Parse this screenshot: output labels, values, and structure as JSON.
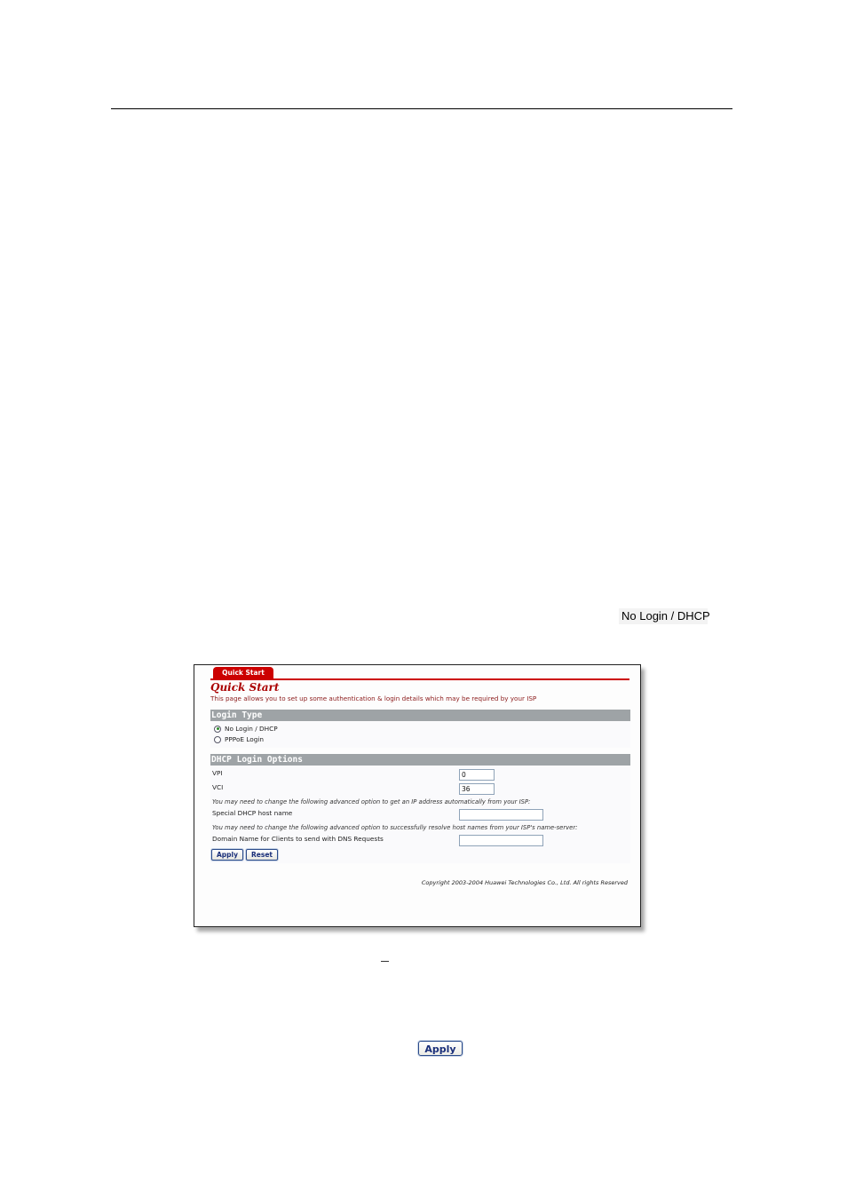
{
  "document": {
    "inline_option_label": "No Login / DHCP",
    "footer_button_label": "Apply",
    "dash_glyph": ""
  },
  "screenshot": {
    "tab_label": "Quick Start",
    "page_title": "Quick Start",
    "description": "This page allows you to set up some authentication & login details which may be required by your ISP",
    "login_type": {
      "header": "Login Type",
      "options": [
        {
          "label": "No Login / DHCP",
          "checked": true
        },
        {
          "label": "PPPoE Login",
          "checked": false
        }
      ]
    },
    "dhcp_options": {
      "header": "DHCP Login Options",
      "vpi_label": "VPI",
      "vpi_value": "0",
      "vci_label": "VCI",
      "vci_value": "36",
      "hint_host": "You may need to change the following advanced option to get an IP address automatically from your ISP:",
      "host_label": "Special DHCP host name",
      "host_value": "",
      "hint_domain": "You may need to change the following advanced option to successfully resolve host names from your ISP's name-server:",
      "domain_label": "Domain Name for Clients to send with DNS Requests",
      "domain_value": ""
    },
    "buttons": {
      "apply": "Apply",
      "reset": "Reset"
    },
    "copyright": "Copyright 2003-2004 Huawei Technologies Co., Ltd. All rights Reserved"
  },
  "colors": {
    "accent_red": "#cc0000",
    "section_gray": "#9ea3a6",
    "button_text_blue": "#1a2f7a"
  }
}
